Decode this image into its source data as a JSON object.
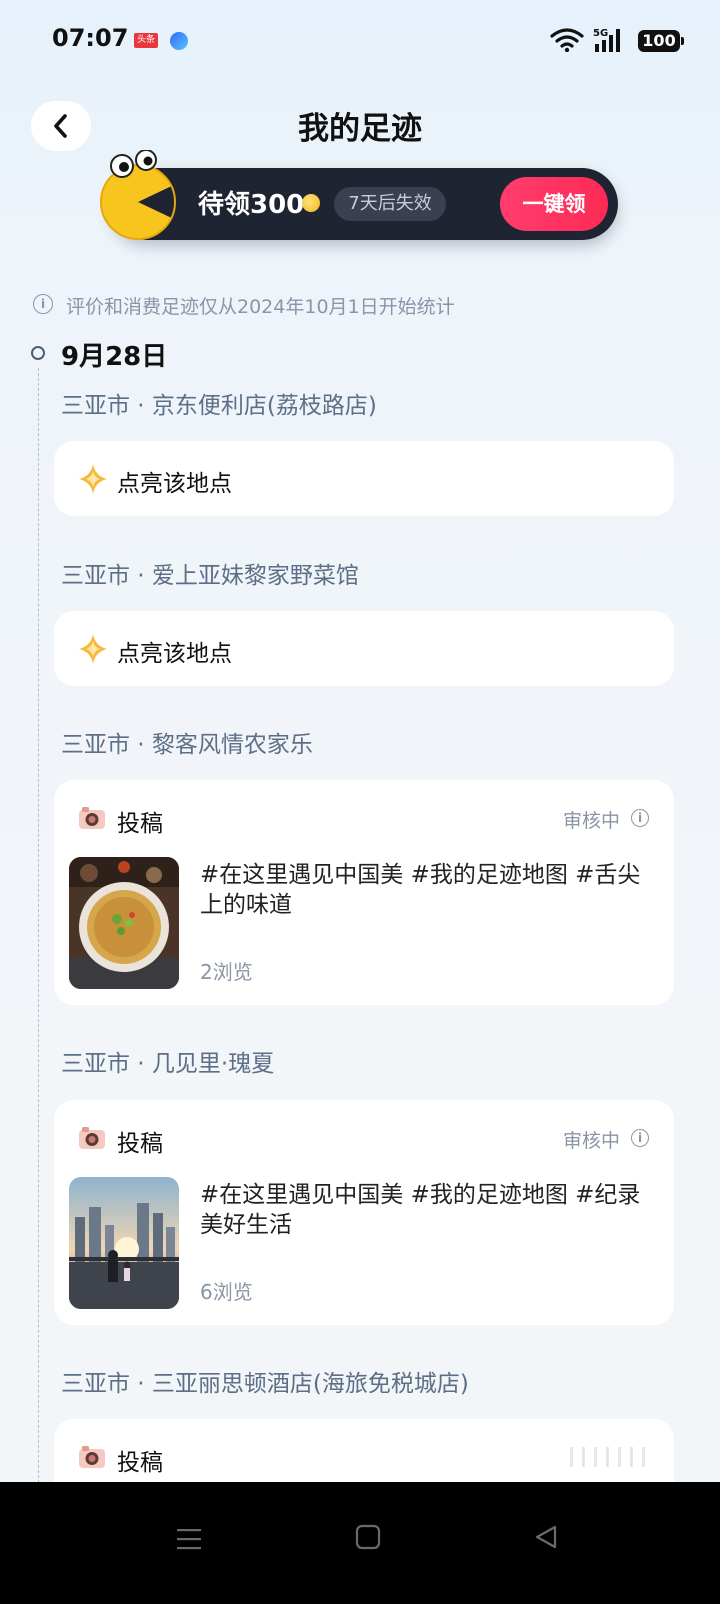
{
  "status_bar": {
    "time": "07:07",
    "news_badge": "头条",
    "battery": "100",
    "network": "5G"
  },
  "header": {
    "title": "我的足迹"
  },
  "banner": {
    "text": "待领300",
    "expire": "7天后失效",
    "claim_button": "一键领"
  },
  "notice": "评价和消费足迹仅从2024年10月1日开始统计",
  "timeline": {
    "date": "9月28日",
    "places": [
      {
        "name": "三亚市 · 京东便利店(荔枝路店)",
        "action": "点亮该地点"
      },
      {
        "name": "三亚市 · 爱上亚妹黎家野菜馆",
        "action": "点亮该地点"
      },
      {
        "name": "三亚市 · 黎客风情农家乐",
        "type": "投稿",
        "status": "审核中",
        "text": "#在这里遇见中国美 #我的足迹地图 #舌尖上的味道",
        "views": "2浏览"
      },
      {
        "name": "三亚市 · 几见里·瑰夏",
        "type": "投稿",
        "status": "审核中",
        "text": "#在这里遇见中国美 #我的足迹地图 #纪录美好生活",
        "views": "6浏览"
      },
      {
        "name": "三亚市 · 三亚丽思顿酒店(海旅免税城店)",
        "type": "投稿"
      }
    ]
  },
  "colors": {
    "accent": "#fe2a55",
    "banner_bg": "#1f2433",
    "place_title": "#5d6f87",
    "muted": "#8a95a6"
  },
  "icons": {
    "back": "chevron-left-icon",
    "sparkle": "sparkle-icon",
    "camera": "camera-icon",
    "info": "info-icon"
  }
}
